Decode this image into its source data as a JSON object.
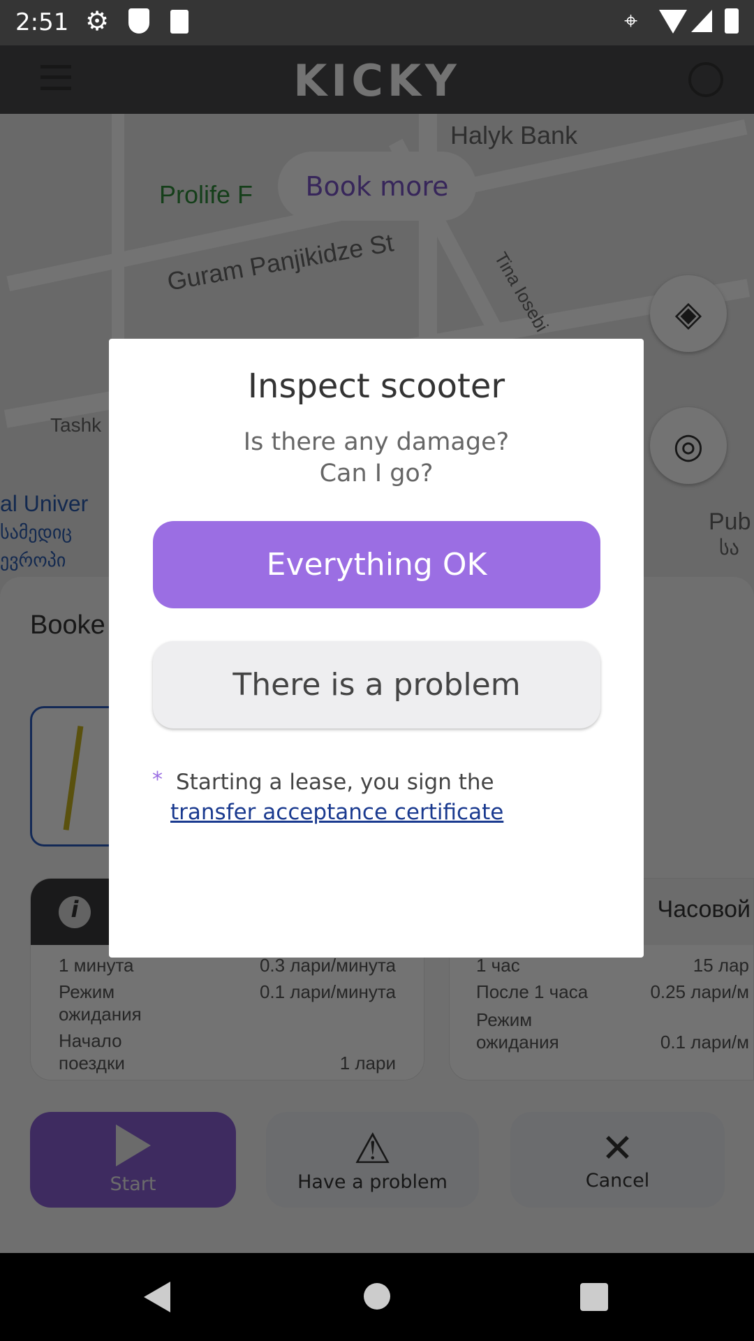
{
  "status_bar": {
    "time": "2:51",
    "icons": [
      "gear-icon",
      "shield-play-icon",
      "sd-card-icon",
      "location-icon",
      "wifi-icon",
      "signal-icon",
      "battery-icon"
    ]
  },
  "app_bar": {
    "logo": "KICKY",
    "menu_icon": "hamburger-icon",
    "notification_icon": "bell-icon"
  },
  "map": {
    "book_more": "Book more",
    "labels": {
      "bank": "Halyk Bank",
      "prolife": "Prolife F",
      "street1": "Guram Panjikidze St",
      "street2": "Tina Iosebi",
      "tash": "Tashk",
      "univ1": "al Univer",
      "univ2": "სამედიც",
      "univ3": "ევროპი",
      "pub1": "Pub",
      "pub2": "სა"
    }
  },
  "sheet": {
    "title": "Booke",
    "tariff_left": {
      "rows": [
        {
          "label": "1 минута",
          "value": "0.3 лари/минута"
        },
        {
          "label": "Режим ожидания",
          "value": "0.1 лари/минута"
        },
        {
          "label": "Начало поездки",
          "value": "1 лари"
        }
      ]
    },
    "tariff_right": {
      "title": "Часовой",
      "rows": [
        {
          "label": "1 час",
          "value": "15 лар"
        },
        {
          "label": "После 1 часа",
          "value": "0.25 лари/м"
        },
        {
          "label": "Режим ожидания",
          "value": "0.1 лари/м"
        }
      ]
    },
    "actions": {
      "start": "Start",
      "problem": "Have a problem",
      "cancel": "Cancel"
    }
  },
  "dialog": {
    "title": "Inspect scooter",
    "subtitle_line1": "Is there any damage?",
    "subtitle_line2": "Can I go?",
    "ok_button": "Everything OK",
    "problem_button": "There is a problem",
    "note_asterisk": "*",
    "note_text": "Starting a lease, you sign the",
    "note_link": "transfer acceptance certificate"
  },
  "colors": {
    "accent": "#9b6ee3",
    "link": "#1a3a8f"
  }
}
